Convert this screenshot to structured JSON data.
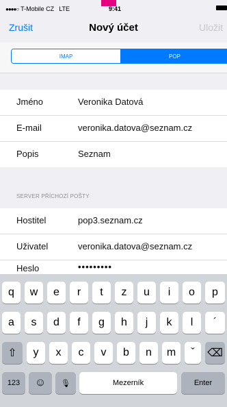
{
  "status_bar": {
    "signal": "●●●●○",
    "carrier": "T-Mobile CZ",
    "network": "LTE",
    "time": "9:41"
  },
  "nav": {
    "cancel": "Zrušit",
    "title": "Nový účet",
    "save": "Uložit"
  },
  "segments": {
    "imap": "IMAP",
    "pop": "POP",
    "selected": "POP"
  },
  "account": [
    {
      "label": "Jméno",
      "value": "Veronika Datová"
    },
    {
      "label": "E-mail",
      "value": "veronika.datova@seznam.cz"
    },
    {
      "label": "Popis",
      "value": "Seznam"
    }
  ],
  "incoming_server": {
    "header": "SERVER PŘÍCHOZÍ POŠTY",
    "rows": [
      {
        "label": "Hostitel",
        "value": "pop3.seznam.cz"
      },
      {
        "label": "Uživatel",
        "value": "veronika.datova@seznam.cz"
      },
      {
        "label": "Heslo",
        "value": "•••••••••"
      }
    ]
  },
  "keyboard": {
    "row1": [
      "q",
      "w",
      "e",
      "r",
      "t",
      "z",
      "u",
      "i",
      "o",
      "p"
    ],
    "row2": [
      "a",
      "s",
      "d",
      "f",
      "g",
      "h",
      "j",
      "k",
      "l",
      "´"
    ],
    "row3": [
      "y",
      "x",
      "c",
      "v",
      "b",
      "n",
      "m",
      "ˇ"
    ],
    "shift": "⇧",
    "delete": "⌫",
    "numbers": "123",
    "emoji": "☺",
    "mic": "🎙",
    "space": "Mezerník",
    "enter": "Enter"
  },
  "colors": {
    "accent": "#007aff",
    "brand": "#e4007f"
  }
}
